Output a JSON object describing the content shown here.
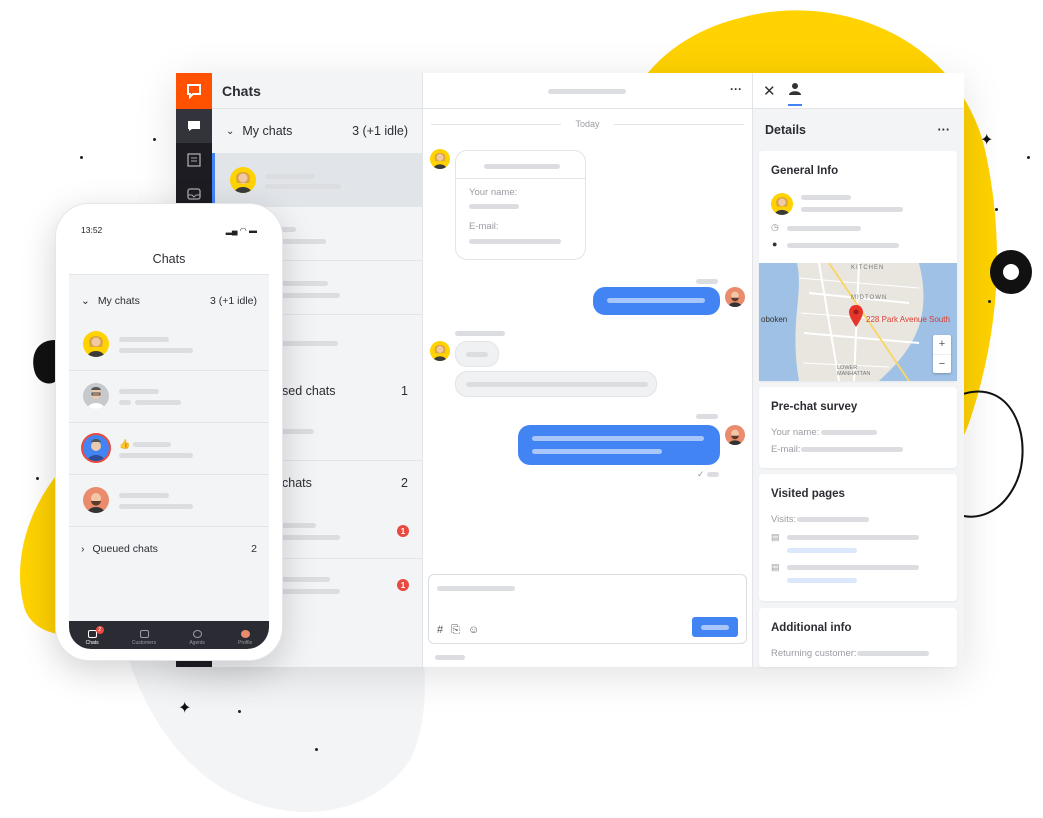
{
  "colors": {
    "brand": "#ff5100",
    "accent": "#4384f5",
    "yellow": "#ffd200",
    "badge": "#e94a3f"
  },
  "desktop": {
    "chatlist": {
      "title": "Chats",
      "my_chats": {
        "label": "My chats",
        "count": "3 (+1 idle)"
      },
      "paused_chats": {
        "label": "Paused chats",
        "visible_label": "sed chats",
        "count": "1"
      },
      "queued": {
        "visible_label": "chats",
        "count": "2"
      },
      "badges": [
        "1",
        "1"
      ]
    },
    "conversation": {
      "today_label": "Today",
      "form_your_name": "Your name:",
      "form_email": "E-mail:",
      "menu_icon": "ellipsis-icon",
      "composer_icons": [
        "#",
        "⎘",
        "☺"
      ]
    },
    "details": {
      "title": "Details",
      "menu": "···",
      "general_info": "General Info",
      "map_address": "228 Park Avenue South",
      "map_labels": [
        "oboken",
        "MIDTOWN",
        "LOWER MANHATTAN",
        "KITCHEN"
      ],
      "map_zoom_in": "+",
      "map_zoom_out": "−",
      "prechat_survey": "Pre-chat survey",
      "prechat_name": "Your name:",
      "prechat_email": "E-mail:",
      "visited_pages": "Visited pages",
      "visits_label": "Visits:",
      "additional_info": "Additional info",
      "returning_customer": "Returning customer:"
    }
  },
  "phone": {
    "time": "13:52",
    "title": "Chats",
    "my_chats": {
      "label": "My chats",
      "count": "3 (+1 idle)"
    },
    "queued_chats": {
      "label": "Queued chats",
      "count": "2"
    },
    "tabs": [
      {
        "label": "Chats",
        "badge": "2"
      },
      {
        "label": "Customers"
      },
      {
        "label": "Agents"
      },
      {
        "label": "Profile"
      }
    ]
  }
}
